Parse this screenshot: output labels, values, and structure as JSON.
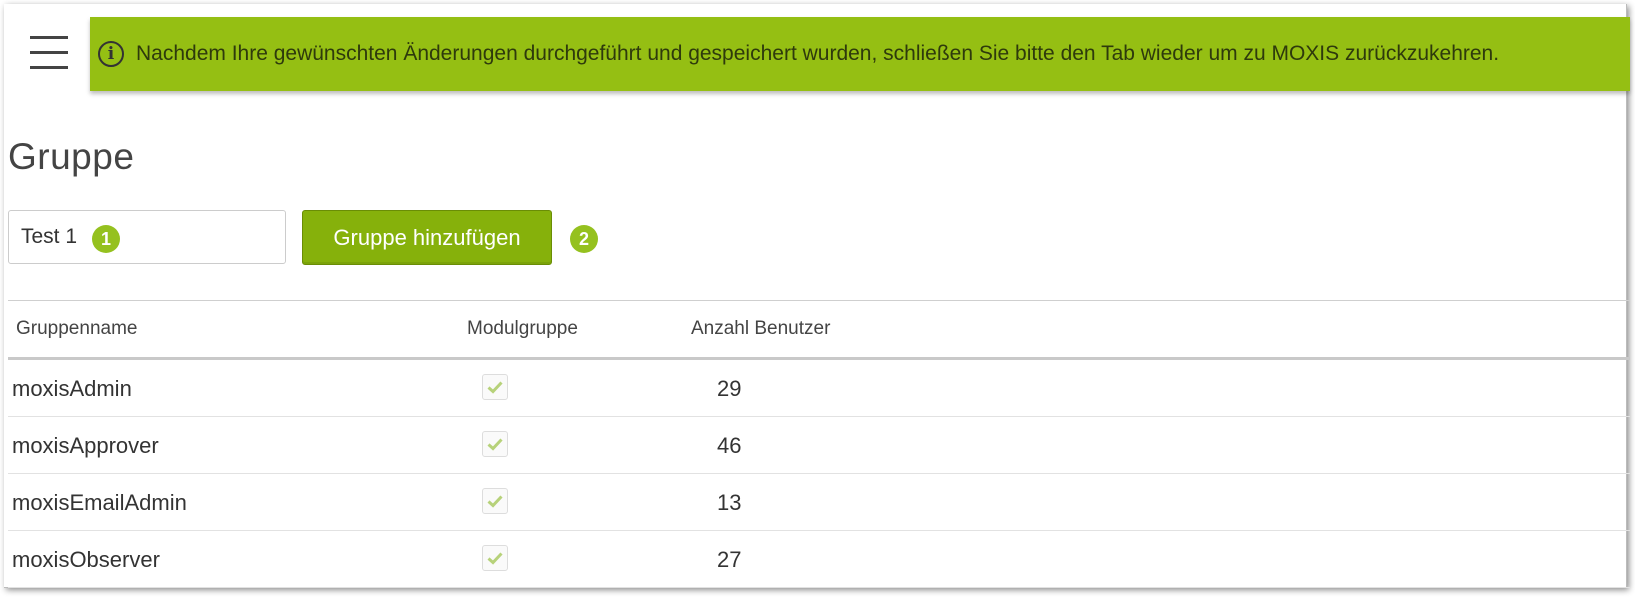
{
  "notification": {
    "icon": "info-icon",
    "message": "Nachdem Ihre gewünschten Änderungen durchgeführt und gespeichert wurden, schließen Sie bitte den Tab wieder um zu MOXIS zurückzukehren.",
    "background": "#95bf13"
  },
  "page": {
    "title": "Gruppe"
  },
  "form": {
    "input_value": "Test 1",
    "add_button_label": "Gruppe hinzufügen",
    "badge_1": "1",
    "badge_2": "2"
  },
  "table": {
    "headers": [
      "Gruppenname",
      "Modulgruppe",
      "Anzahl Benutzer"
    ],
    "rows": [
      {
        "name": "moxisAdmin",
        "modulgruppe": true,
        "count": "29"
      },
      {
        "name": "moxisApprover",
        "modulgruppe": true,
        "count": "46"
      },
      {
        "name": "moxisEmailAdmin",
        "modulgruppe": true,
        "count": "13"
      },
      {
        "name": "moxisObserver",
        "modulgruppe": true,
        "count": "27"
      }
    ]
  },
  "colors": {
    "accent": "#95bf13",
    "button": "#86b10b",
    "check": "#b7d27a"
  }
}
